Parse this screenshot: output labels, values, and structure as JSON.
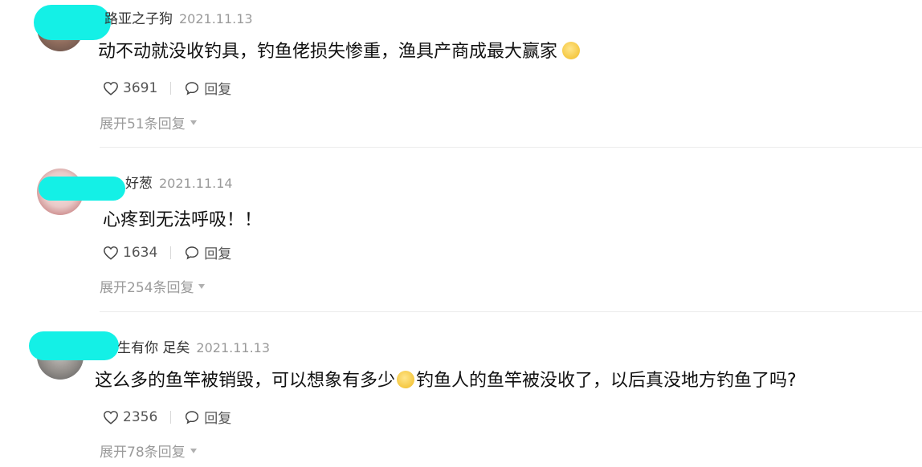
{
  "comments": [
    {
      "username": "路亚之子狗",
      "date": "2021.11.13",
      "text": "动不动就没收钓具，钓鱼佬损失惨重，渔具产商成最大赢家",
      "emoji": "pleading-face-emoji",
      "likes": "3691",
      "reply_label": "回复",
      "expand_label": "展开51条回复"
    },
    {
      "username": "好葱",
      "date": "2021.11.14",
      "text": "心疼到无法呼吸！！",
      "likes": "1634",
      "reply_label": "回复",
      "expand_label": "展开254条回复"
    },
    {
      "username": "生有你 足矣",
      "date": "2021.11.13",
      "text_before": "这么多的鱼竿被销毁，可以想象有多少",
      "emoji": "rolling-eyes-emoji",
      "text_after": "钓鱼人的鱼竿被没收了，以后真没地方钓鱼了吗?",
      "likes": "2356",
      "reply_label": "回复",
      "expand_label": "展开78条回复"
    }
  ],
  "icons": {
    "like": "heart-icon",
    "reply": "speech-bubble-icon",
    "expand": "caret-down-icon"
  },
  "colors": {
    "redaction": "#14f0e6",
    "muted": "#9a9a9a"
  }
}
